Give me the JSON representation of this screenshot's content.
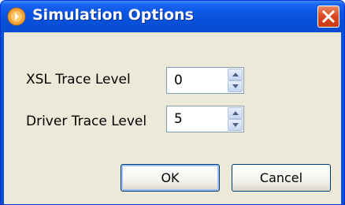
{
  "window": {
    "title": "Simulation Options",
    "app_icon": "app-icon",
    "close_icon": "close-icon"
  },
  "fields": [
    {
      "label": "XSL Trace Level",
      "value": "0"
    },
    {
      "label": "Driver Trace Level",
      "value": "5"
    }
  ],
  "buttons": {
    "ok_label": "OK",
    "cancel_label": "Cancel"
  },
  "colors": {
    "titlebar": "#0a4cd0",
    "client_bg": "#ece9d8",
    "close_button": "#d64a22"
  }
}
